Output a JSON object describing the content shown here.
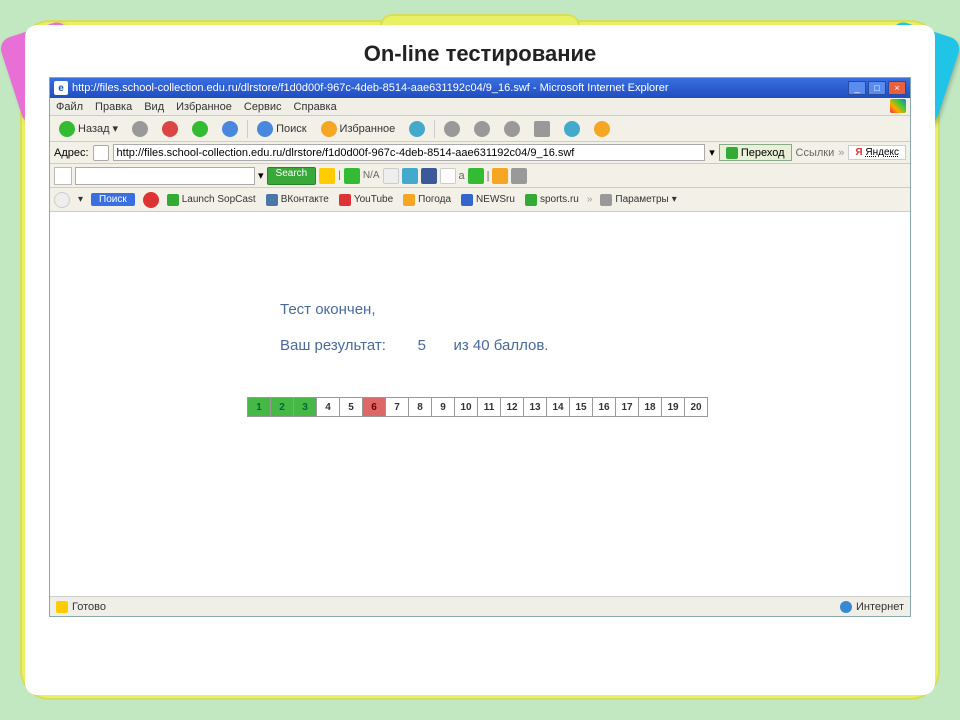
{
  "page_heading": "On-line тестирование",
  "titlebar": {
    "url_title": "http://files.school-collection.edu.ru/dlrstore/f1d0d00f-967c-4deb-8514-aae631192c04/9_16.swf - Microsoft Internet Explorer"
  },
  "winbuttons": {
    "min": "_",
    "max": "□",
    "close": "×"
  },
  "menus": {
    "file": "Файл",
    "edit": "Правка",
    "view": "Вид",
    "fav": "Избранное",
    "tools": "Сервис",
    "help": "Справка"
  },
  "toolbar": {
    "back": "Назад",
    "search": "Поиск",
    "favorites": "Избранное"
  },
  "address": {
    "label": "Адрес:",
    "value": "http://files.school-collection.edu.ru/dlrstore/f1d0d00f-967c-4deb-8514-aae631192c04/9_16.swf",
    "go": "Переход",
    "links_label": "Ссылки",
    "yandex": "Яндекс"
  },
  "searchbar": {
    "button": "Search",
    "na": "N/A"
  },
  "linksbar": {
    "poisk": "Поиск",
    "items": [
      {
        "label": "Launch SopCast",
        "color": "#3a3"
      },
      {
        "label": "ВКонтакте",
        "color": "#4a76a8"
      },
      {
        "label": "YouTube",
        "color": "#d33"
      },
      {
        "label": "Погода",
        "color": "#f5a623"
      },
      {
        "label": "NEWSru",
        "color": "#36c"
      },
      {
        "label": "sports.ru",
        "color": "#3a3"
      }
    ],
    "params": "Параметры"
  },
  "test": {
    "finished": "Тест окончен,",
    "result_label": "Ваш результат:",
    "score": "5",
    "of_label": "из 40 баллов."
  },
  "questions": [
    {
      "n": "1",
      "state": "correct"
    },
    {
      "n": "2",
      "state": "correct"
    },
    {
      "n": "3",
      "state": "correct"
    },
    {
      "n": "4",
      "state": ""
    },
    {
      "n": "5",
      "state": ""
    },
    {
      "n": "6",
      "state": "wrong"
    },
    {
      "n": "7",
      "state": ""
    },
    {
      "n": "8",
      "state": ""
    },
    {
      "n": "9",
      "state": ""
    },
    {
      "n": "10",
      "state": ""
    },
    {
      "n": "11",
      "state": ""
    },
    {
      "n": "12",
      "state": ""
    },
    {
      "n": "13",
      "state": ""
    },
    {
      "n": "14",
      "state": ""
    },
    {
      "n": "15",
      "state": ""
    },
    {
      "n": "16",
      "state": ""
    },
    {
      "n": "17",
      "state": ""
    },
    {
      "n": "18",
      "state": ""
    },
    {
      "n": "19",
      "state": ""
    },
    {
      "n": "20",
      "state": ""
    }
  ],
  "status": {
    "ready": "Готово",
    "zone": "Интернет"
  }
}
